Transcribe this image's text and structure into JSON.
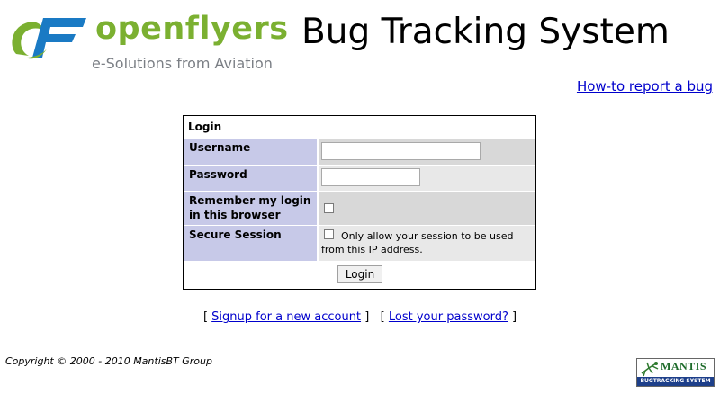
{
  "header": {
    "logo_word": "openflyers",
    "logo_tagline": "e-Solutions from Aviation",
    "site_title": "Bug Tracking System",
    "howto_link": "How-to report a bug"
  },
  "login": {
    "title": "Login",
    "username_label": "Username",
    "username_value": "",
    "password_label": "Password",
    "password_value": "",
    "remember_label": "Remember my login in this browser",
    "remember_checked": false,
    "secure_label": "Secure Session",
    "secure_text": "Only allow your session to be used from this IP address.",
    "secure_checked": false,
    "submit_label": "Login"
  },
  "links": {
    "bracket_open": "[",
    "bracket_close": "]",
    "signup": "Signup for a new account",
    "lost_password": "Lost your password?"
  },
  "footer": {
    "copyright": "Copyright © 2000 - 2010 MantisBT Group",
    "badge_title": "MANTIS",
    "badge_subtitle": "BUGTRACKING SYSTEM"
  },
  "colors": {
    "label_bg": "#c7c9e8",
    "row_dark": "#d8d8d8",
    "row_light": "#e8e8e8",
    "logo_green": "#7bb031",
    "logo_blue": "#1a7ac4",
    "link": "#0000cc"
  },
  "icons": {
    "logo": "openflyers-logo-icon",
    "badge_bug": "mantis-bug-icon"
  }
}
